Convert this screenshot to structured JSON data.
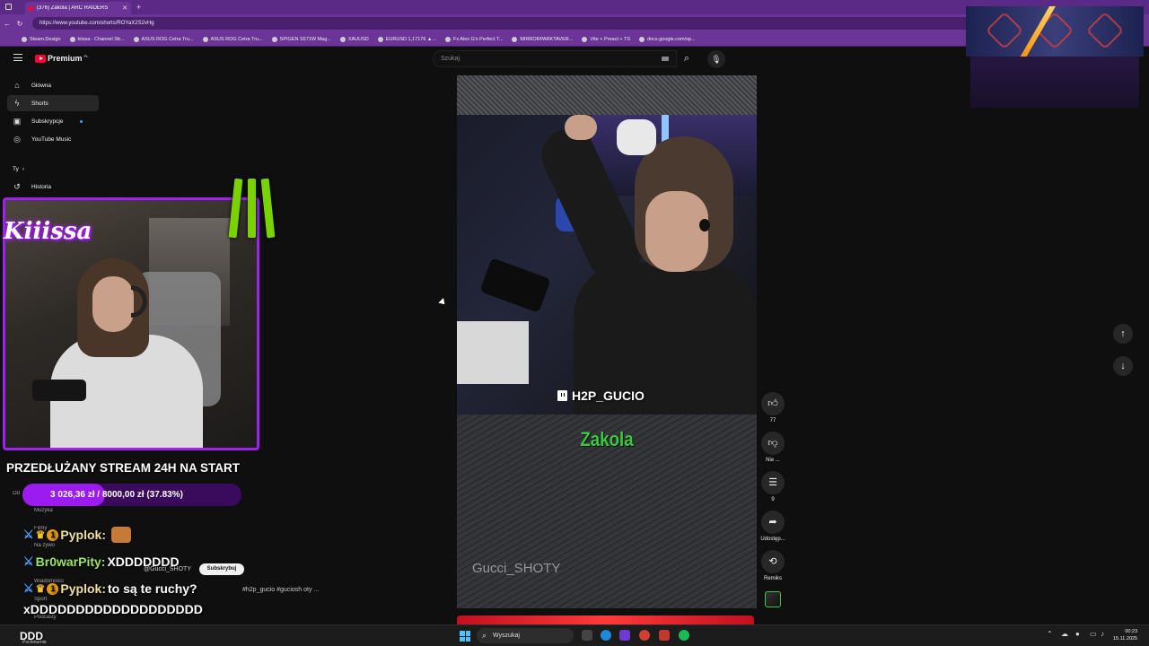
{
  "browser": {
    "tab_title": "(376) Zakola | ARC RAIDERS",
    "url": "https://www.youtube.com/shorts/ROYaX2S2vHg",
    "bookmarks": [
      "Steam.Design",
      "kiissa - Channel Str...",
      "ASUS ROG Cetra Tru...",
      "ASUS ROG Cetra Tru...",
      "SPIGEN S571W Mag...",
      "XAUUSD",
      "EURUSD 1,17176 ▲...",
      "Fx Alex G's Perfect T...",
      "MIRRORPARKTAVER...",
      "Vite + Preact + TS",
      "docs.google.com/sp..."
    ]
  },
  "youtube": {
    "logo_text": "Premium",
    "logo_sup": "PL",
    "search_placeholder": "Szukaj",
    "sidebar": [
      {
        "label": "Główna",
        "icon": "home-icon"
      },
      {
        "label": "Shorts",
        "icon": "shorts-icon"
      },
      {
        "label": "Subskrypcje",
        "icon": "subscriptions-icon"
      },
      {
        "label": "YouTube Music",
        "icon": "music-icon"
      }
    ],
    "you_section": "Ty",
    "history_label": "Historia",
    "faint_items": [
      "Muzyka",
      "Filmy",
      "Na żywo",
      "Wiadomości",
      "Sport",
      "Podcasty",
      "Od"
    ]
  },
  "stream_overlay": {
    "brand": "Kiiissa",
    "title": "PRZEDŁUŻANY STREAM 24H NA START",
    "donation_text": "3 026,36 zł / 8000,00 zł (37.83%)",
    "donation_progress": 0.3783,
    "chat": [
      {
        "name": "Pyplok:",
        "message": "",
        "badges": [
          "sword",
          "crown",
          "1"
        ],
        "emote": "cat-emote"
      },
      {
        "name": "Br0warPity:",
        "message": "XDDDDDDD",
        "badges": [
          "sword"
        ],
        "emote": ""
      },
      {
        "name": "Pyplok:",
        "message": "to są te ruchy?",
        "badges": [
          "sword",
          "crown",
          "1"
        ],
        "emote": ""
      },
      {
        "name": "",
        "message": "xDDDDDDDDDDDDDDDDDDD",
        "badges": [],
        "emote": ""
      }
    ],
    "chat_channel": "@Gucci_SHOTY",
    "subscribe_label": "Subskrybuj",
    "chat_desc": "#h2p_gucio #guciosh oty ..."
  },
  "short": {
    "twitch_tag": "H2P_GUCIO",
    "title": "Zakola",
    "watermark": "Gucci_SHOTY",
    "actions": [
      {
        "label": "77",
        "icon": "like-icon"
      },
      {
        "label": "Nie ...",
        "icon": "dislike-icon"
      },
      {
        "label": "9",
        "icon": "comment-icon"
      },
      {
        "label": "Udostęp...",
        "icon": "share-icon"
      },
      {
        "label": "Remiks",
        "icon": "remix-icon"
      }
    ]
  },
  "taskbar": {
    "weather_temp": "DDD",
    "weather_desc": "Pochmurnie",
    "search_placeholder": "Wyszukaj",
    "time": "00:23",
    "date": "15.11.2025"
  },
  "colors": {
    "browser_chrome": "#6a3597",
    "youtube_bg": "#0f0f0f",
    "overlay_purple": "#9b1bf0",
    "title_green": "#39c93e",
    "youtube_red": "#ff0033"
  }
}
